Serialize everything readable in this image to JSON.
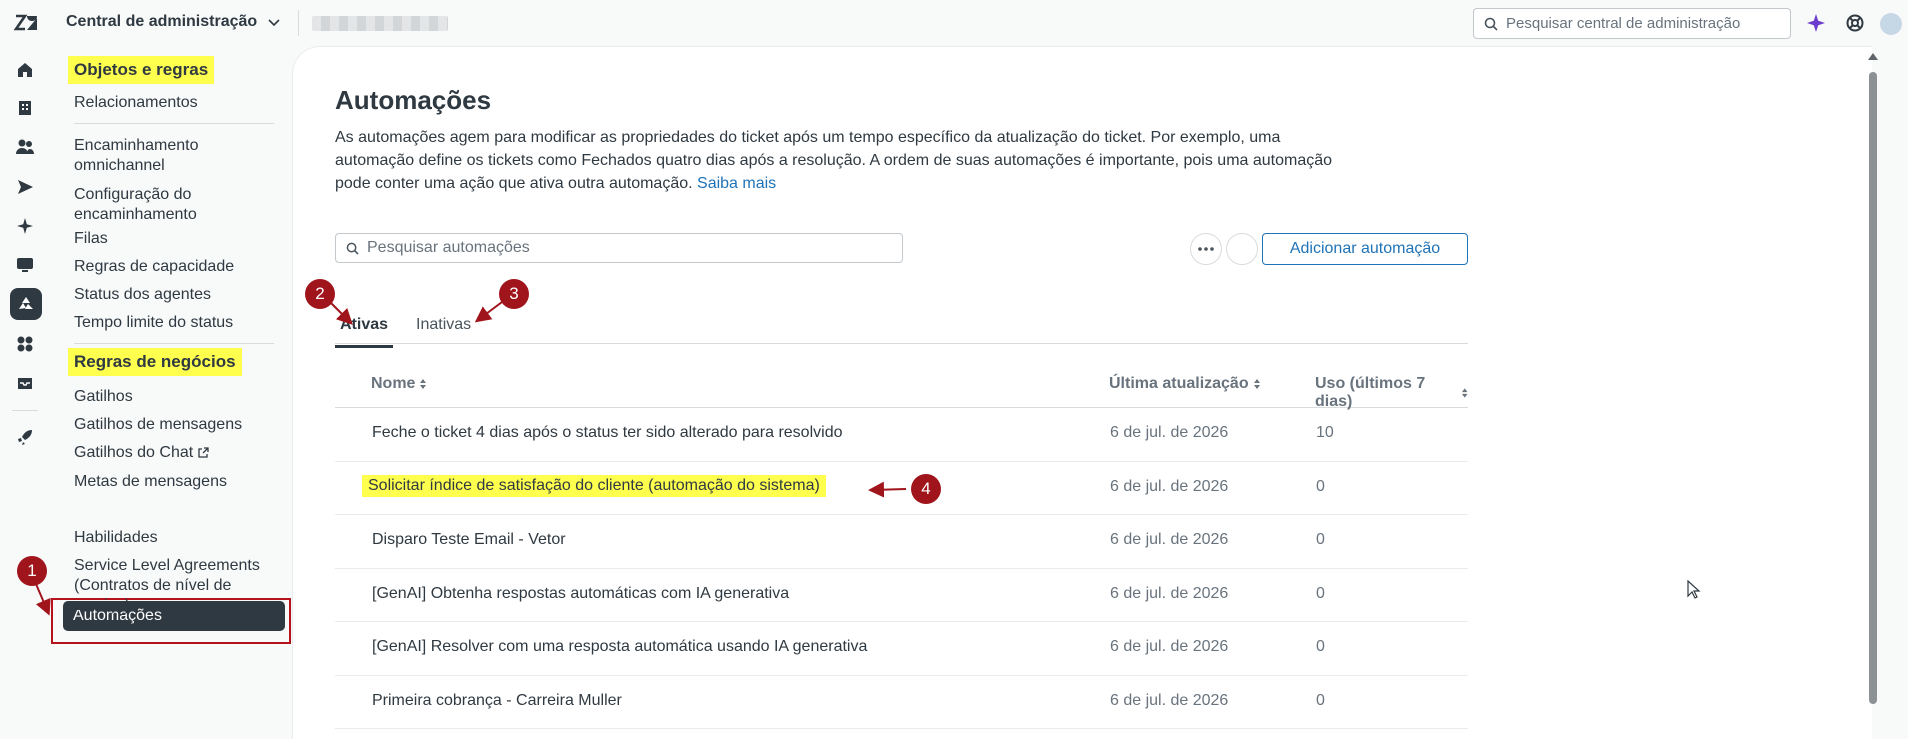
{
  "topbar": {
    "product_name": "Central de administração",
    "search_placeholder": "Pesquisar central de administração"
  },
  "nav": {
    "section1_title": "Objetos e regras",
    "item_relacionamentos": "Relacionamentos",
    "heading_encaminhamento": "Encaminhamento omnichannel",
    "item_config_encaminhamento": "Configuração do encaminhamento",
    "item_filas": "Filas",
    "item_regras_capacidade": "Regras de capacidade",
    "item_status_agentes": "Status dos agentes",
    "item_tempo_limite": "Tempo limite do status",
    "section2_title": "Regras de negócios",
    "item_gatilhos": "Gatilhos",
    "item_gatilhos_mensagens": "Gatilhos de mensagens",
    "item_gatilhos_chat": "Gatilhos do Chat",
    "item_metas_mensagens": "Metas de mensagens",
    "item_automacoes": "Automações",
    "item_habilidades": "Habilidades",
    "item_sla": "Service Level Agreements (Contratos de nível de serviço)"
  },
  "page": {
    "title": "Automações",
    "description": "As automações agem para modificar as propriedades do ticket após um tempo específico da atualização do ticket. Por exemplo, uma automação define os tickets como Fechados quatro dias após a resolução. A ordem de suas automações é importante, pois uma automação pode conter uma ação que ativa outra automação.",
    "learn_more": "Saiba mais",
    "search_placeholder": "Pesquisar automações",
    "add_button": "Adicionar automação",
    "tab_active": "Ativas",
    "tab_inactive": "Inativas"
  },
  "table": {
    "col_name": "Nome",
    "col_updated": "Última atualização",
    "col_usage": "Uso (últimos 7 dias)",
    "rows": [
      {
        "name": "Feche o ticket 4 dias após o status ter sido alterado para resolvido",
        "updated": "6 de jul. de 2026",
        "usage": "10"
      },
      {
        "name": "Solicitar índice de satisfação do cliente (automação do sistema)",
        "updated": "6 de jul. de 2026",
        "usage": "0"
      },
      {
        "name": "Disparo Teste Email - Vetor",
        "updated": "6 de jul. de 2026",
        "usage": "0"
      },
      {
        "name": "[GenAI] Obtenha respostas automáticas com IA generativa",
        "updated": "6 de jul. de 2026",
        "usage": "0"
      },
      {
        "name": "[GenAI] Resolver com uma resposta automática usando IA generativa",
        "updated": "6 de jul. de 2026",
        "usage": "0"
      },
      {
        "name": "Primeira cobrança - Carreira Muller",
        "updated": "6 de jul. de 2026",
        "usage": "0"
      }
    ]
  },
  "annotations": [
    "1",
    "2",
    "3",
    "4"
  ],
  "colors": {
    "annotation": "#a0141c",
    "highlight": "#ffff4d",
    "link": "#1f73b7"
  }
}
